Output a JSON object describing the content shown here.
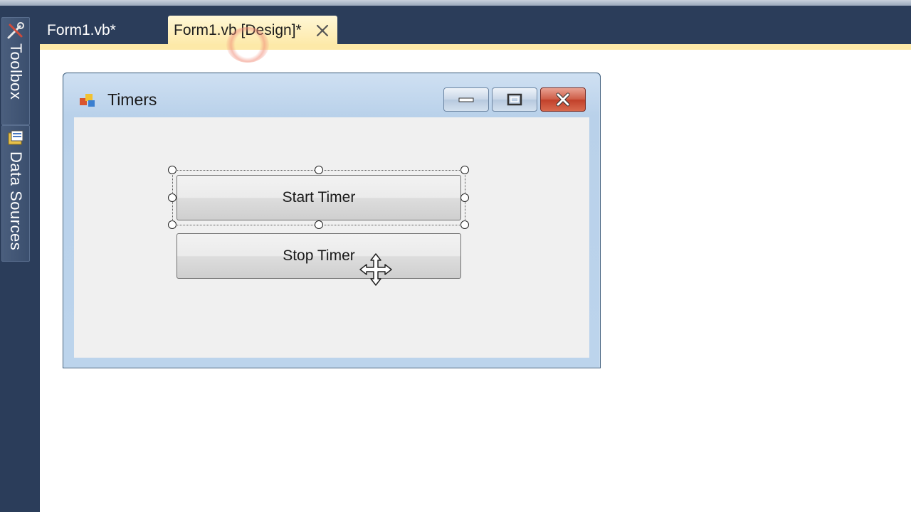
{
  "tabs": [
    {
      "label": "Form1.vb*",
      "active": false
    },
    {
      "label": "Form1.vb [Design]*",
      "active": true
    }
  ],
  "dock": {
    "toolbox_label": "Toolbox",
    "datasources_label": "Data Sources"
  },
  "form": {
    "title": "Timers",
    "buttons": {
      "start_label": "Start Timer",
      "stop_label": "Stop Timer"
    }
  },
  "icons": {
    "toolbox": "toolbox-icon",
    "datasources": "data-sources-icon",
    "tab_close": "close-icon",
    "form": "form-icon",
    "minimize": "minimize-icon",
    "maximize": "maximize-icon",
    "close": "close-icon",
    "cursor": "move-cursor-icon"
  },
  "colors": {
    "ide_background": "#2b3d5a",
    "active_tab": "#fde9a8",
    "form_client": "#f0f0f0",
    "close_button": "#c1402a"
  }
}
